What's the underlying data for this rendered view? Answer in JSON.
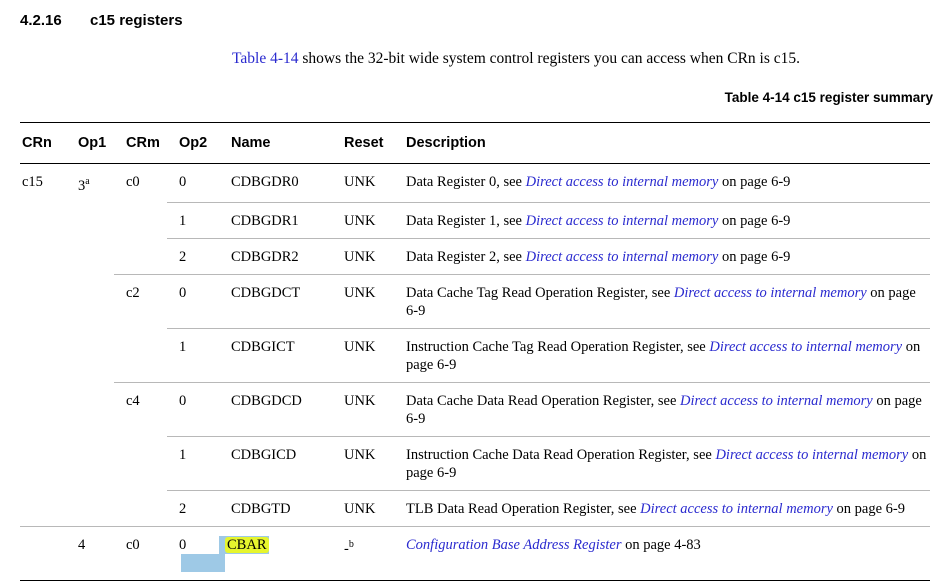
{
  "section": {
    "number": "4.2.16",
    "title": "c15 registers"
  },
  "intro": {
    "link": "Table 4-14",
    "text": " shows the 32-bit wide system control registers you can access when CRn is c15."
  },
  "table": {
    "caption": "Table 4-14 c15 register summary",
    "headers": {
      "crn": "CRn",
      "op1": "Op1",
      "crm": "CRm",
      "op2": "Op2",
      "name": "Name",
      "reset": "Reset",
      "description": "Description"
    },
    "rows": [
      {
        "crn": "c15",
        "op1": "3",
        "op1_sup": "a",
        "crm": "c0",
        "op2": "0",
        "name": "CDBGDR0",
        "reset": "UNK",
        "desc_pre": "Data Register 0, see ",
        "desc_link": "Direct access to internal memory",
        "desc_post": " on page 6-9"
      },
      {
        "crn": "",
        "op1": "",
        "op1_sup": "",
        "crm": "",
        "op2": "1",
        "name": "CDBGDR1",
        "reset": "UNK",
        "desc_pre": "Data Register 1, see ",
        "desc_link": "Direct access to internal memory",
        "desc_post": " on page 6-9"
      },
      {
        "crn": "",
        "op1": "",
        "op1_sup": "",
        "crm": "",
        "op2": "2",
        "name": "CDBGDR2",
        "reset": "UNK",
        "desc_pre": "Data Register 2, see ",
        "desc_link": "Direct access to internal memory",
        "desc_post": " on page 6-9"
      },
      {
        "crn": "",
        "op1": "",
        "op1_sup": "",
        "crm": "c2",
        "op2": "0",
        "name": "CDBGDCT",
        "reset": "UNK",
        "desc_pre": "Data Cache Tag Read Operation Register, see ",
        "desc_link": "Direct access to internal memory",
        "desc_post": " on page 6-9"
      },
      {
        "crn": "",
        "op1": "",
        "op1_sup": "",
        "crm": "",
        "op2": "1",
        "name": "CDBGICT",
        "reset": "UNK",
        "desc_pre": "Instruction Cache Tag Read Operation Register, see ",
        "desc_link": "Direct access to internal memory",
        "desc_post": " on page 6-9"
      },
      {
        "crn": "",
        "op1": "",
        "op1_sup": "",
        "crm": "c4",
        "op2": "0",
        "name": "CDBGDCD",
        "reset": "UNK",
        "desc_pre": "Data Cache Data Read Operation Register, see ",
        "desc_link": "Direct access to internal memory",
        "desc_post": " on page 6-9"
      },
      {
        "crn": "",
        "op1": "",
        "op1_sup": "",
        "crm": "",
        "op2": "1",
        "name": "CDBGICD",
        "reset": "UNK",
        "desc_pre": "Instruction Cache Data Read Operation Register, see ",
        "desc_link": "Direct access to internal memory",
        "desc_post": " on page 6-9"
      },
      {
        "crn": "",
        "op1": "",
        "op1_sup": "",
        "crm": "",
        "op2": "2",
        "name": "CDBGTD",
        "reset": "UNK",
        "desc_pre": "TLB Data Read Operation Register, see ",
        "desc_link": "Direct access to internal memory",
        "desc_post": " on page 6-9"
      },
      {
        "crn": "",
        "op1": "4",
        "op1_sup": "",
        "crm": "c0",
        "op2": "0",
        "name": "CBAR",
        "reset": "-",
        "reset_sup": "b",
        "desc_pre": "",
        "desc_link": "Configuration Base Address Register",
        "desc_post": " on page 4-83"
      }
    ]
  }
}
